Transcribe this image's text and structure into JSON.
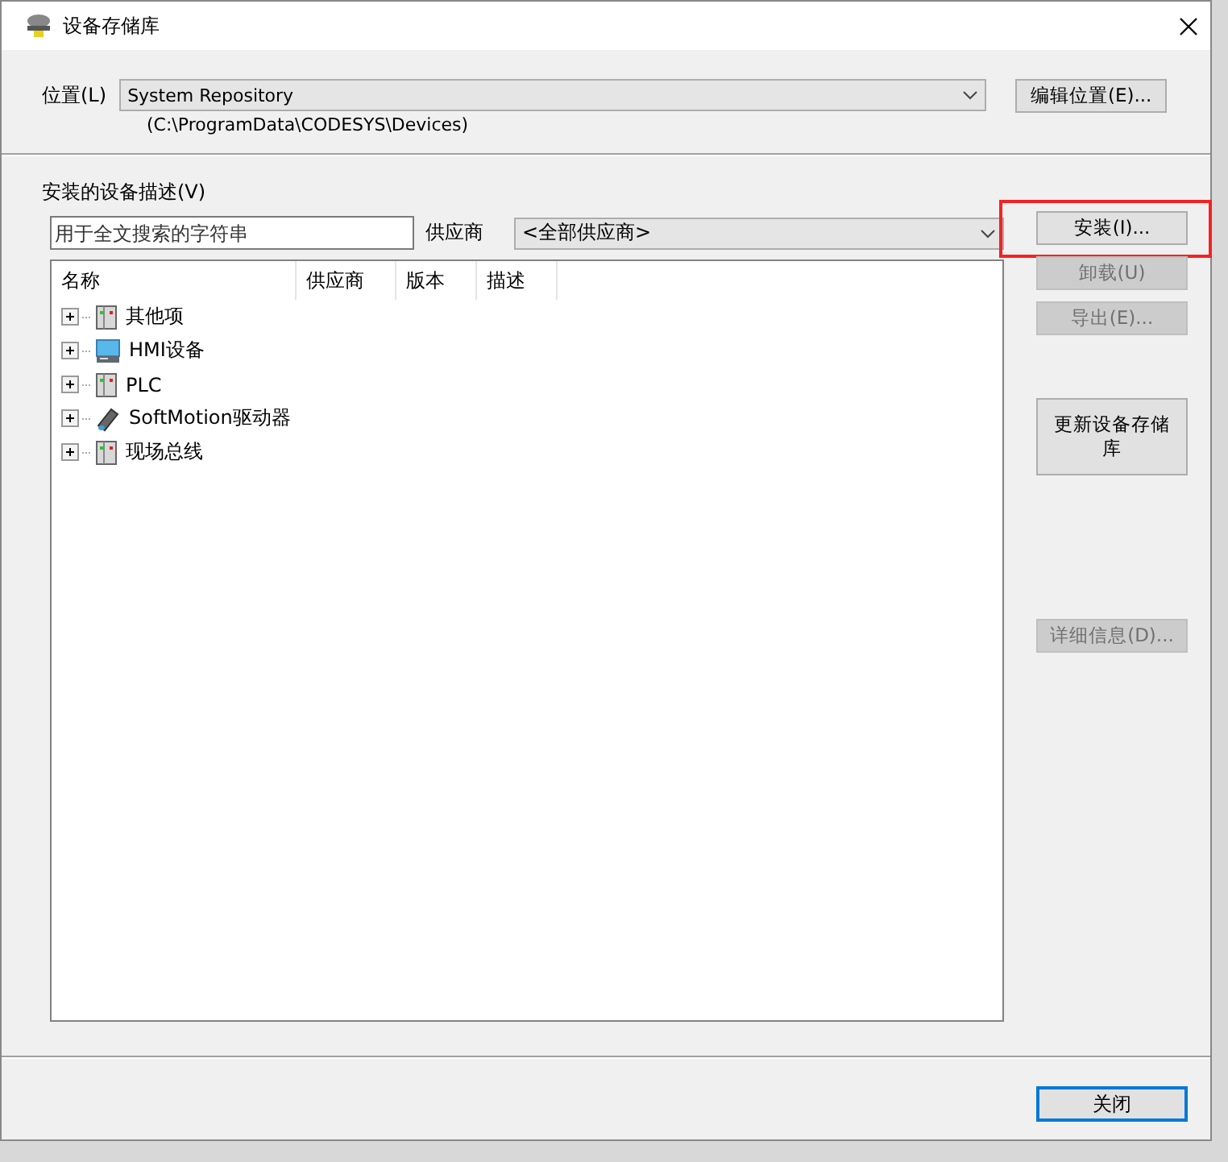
{
  "window": {
    "title": "设备存储库"
  },
  "location": {
    "label": "位置(L)",
    "value": "System Repository",
    "path": "(C:\\ProgramData\\CODESYS\\Devices)",
    "edit_button": "编辑位置(E)..."
  },
  "installed": {
    "label": "安装的设备描述(V)",
    "search": {
      "placeholder": "用于全文搜索的字符串"
    },
    "vendor_label": "供应商",
    "vendor_value": "<全部供应商>"
  },
  "table": {
    "columns": [
      "名称",
      "供应商",
      "版本",
      "描述"
    ],
    "rows": [
      {
        "name": "其他项",
        "kind": "module",
        "expanded": false
      },
      {
        "name": "HMI设备",
        "kind": "hmi",
        "expanded": false
      },
      {
        "name": "PLC",
        "kind": "module",
        "expanded": false
      },
      {
        "name": "SoftMotion驱动器",
        "kind": "drive",
        "expanded": false
      },
      {
        "name": "现场总线",
        "kind": "module",
        "expanded": false
      }
    ]
  },
  "side_buttons": [
    {
      "label": "安装(I)...",
      "disabled": false,
      "highlighted": true,
      "kind": "small"
    },
    {
      "label": "卸载(U)",
      "disabled": true,
      "highlighted": false,
      "kind": "small"
    },
    {
      "label": "导出(E)...",
      "disabled": true,
      "highlighted": false,
      "kind": "small"
    },
    {
      "label": "更新设备存储库",
      "disabled": false,
      "highlighted": false,
      "kind": "tall"
    },
    {
      "label": "详细信息(D)...",
      "disabled": true,
      "highlighted": false,
      "kind": "small"
    }
  ],
  "close_button": "关闭"
}
